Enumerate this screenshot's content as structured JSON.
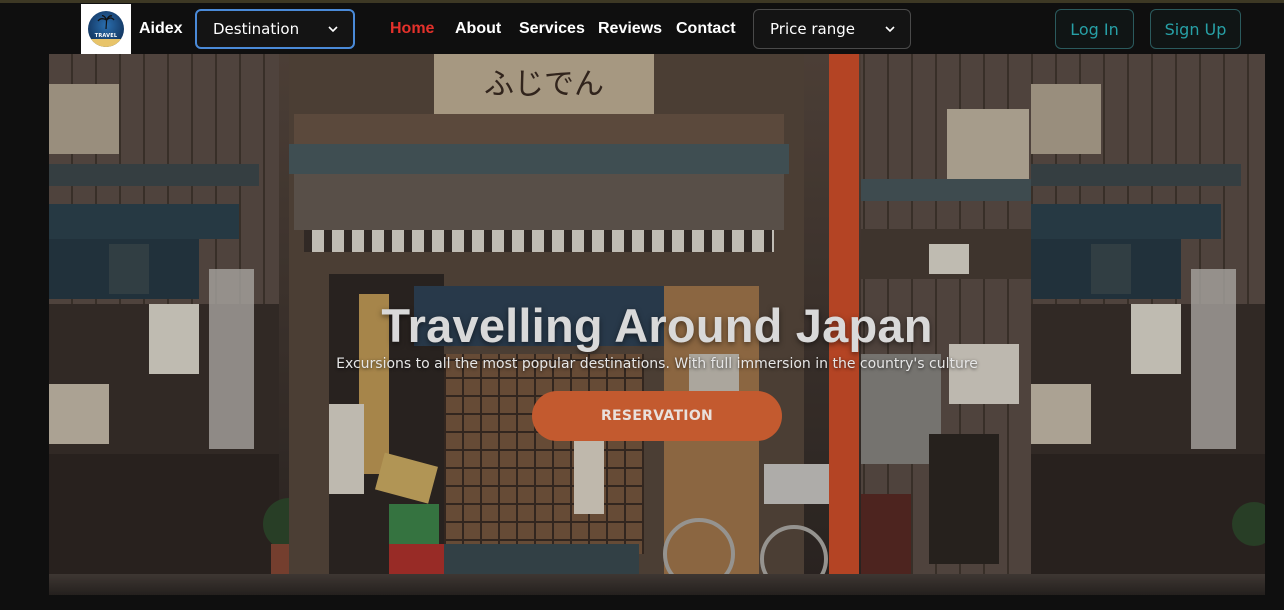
{
  "header": {
    "logo_text": "TRAVEL",
    "brand": "Aidex",
    "destination_select": {
      "selected": "Destination"
    },
    "nav": [
      {
        "label": "Home",
        "active": true
      },
      {
        "label": "About",
        "active": false
      },
      {
        "label": "Services",
        "active": false
      },
      {
        "label": "Reviews",
        "active": false
      },
      {
        "label": "Contact",
        "active": false
      }
    ],
    "price_select": {
      "selected": "Price range"
    },
    "login_label": "Log In",
    "signup_label": "Sign Up"
  },
  "hero": {
    "title": "Travelling Around Japan",
    "subtitle": "Excursions to all the most popular destinations. With full immersion in the country's culture",
    "cta_label": "RESERVATION",
    "background_image": "japanese-shop-street-photo",
    "sign_top": "ふじでん"
  },
  "colors": {
    "accent_active": "#e4312b",
    "teal": "#27a0a6",
    "cta": "#c35a2f",
    "select_focus": "#4a8ad8"
  }
}
